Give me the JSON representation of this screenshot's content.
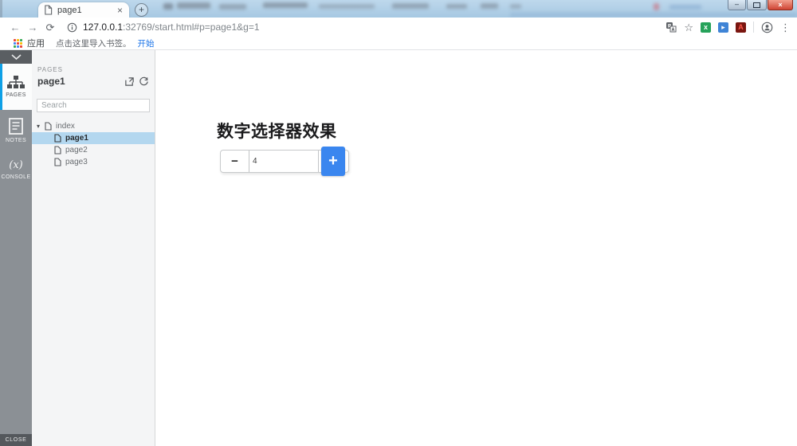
{
  "browser": {
    "tab_title": "page1",
    "address": {
      "host": "127.0.0.1",
      "rest": ":32769/start.html#p=page1&g=1"
    },
    "bookmarks": {
      "apps_label": "应用",
      "import_hint": "点击这里导入书签。",
      "start_link": "开始"
    }
  },
  "icons": {
    "tab_close": "×",
    "new_tab": "+",
    "win_minimize": "–",
    "win_close": "×",
    "back": "←",
    "forward": "→",
    "reload": "⟳",
    "star": "☆",
    "menu": "⋮",
    "caret_down": "▾"
  },
  "sidebar": {
    "pages_label": "PAGES",
    "notes_label": "NOTES",
    "console_glyph": "(x)",
    "console_label": "CONSOLE",
    "close_label": "CLOSE"
  },
  "panel": {
    "section_label": "PAGES",
    "current_page": "page1",
    "search_placeholder": "Search",
    "tree": [
      {
        "label": "index"
      },
      {
        "label": "page1"
      },
      {
        "label": "page2"
      },
      {
        "label": "page3"
      }
    ]
  },
  "main": {
    "heading": "数字选择器效果",
    "stepper": {
      "minus": "−",
      "value": "4",
      "plus": "+"
    }
  },
  "colors": {
    "accent_blue": "#3a86ef",
    "rail_active_bar": "#0ea0e6",
    "tree_selected": "#b3d7ef",
    "link_blue": "#1a73e8"
  }
}
